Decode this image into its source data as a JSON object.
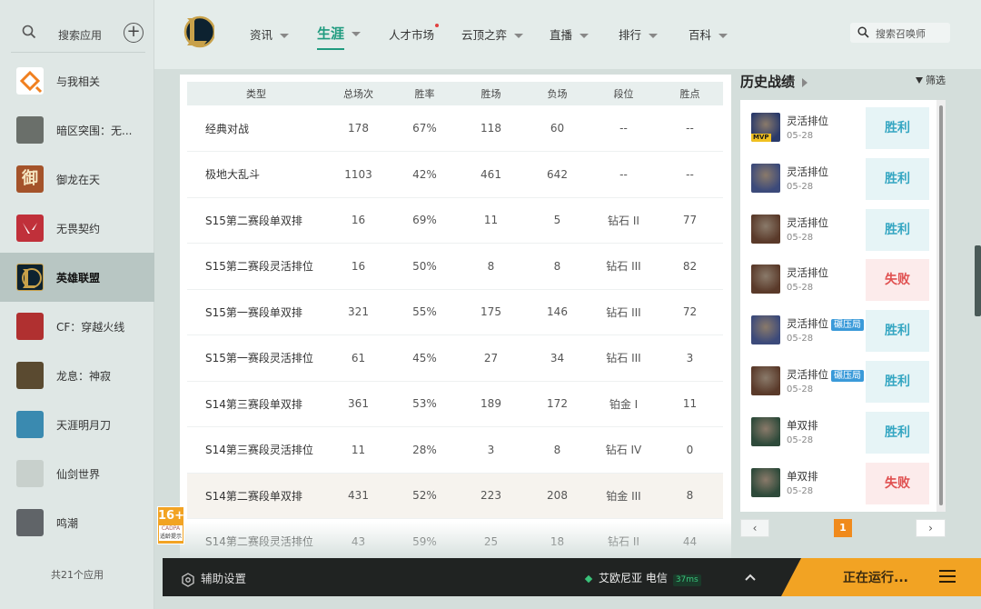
{
  "sidebar": {
    "search_label": "搜索应用",
    "items": [
      {
        "label": "与我相关",
        "icon": "related-icon"
      },
      {
        "label": "暗区突围：无...",
        "icon": "arena-breakout-game-icon"
      },
      {
        "label": "御龙在天",
        "icon": "yulong-game-icon"
      },
      {
        "label": "无畏契约",
        "icon": "valorant-game-icon"
      },
      {
        "label": "英雄联盟",
        "icon": "lol-game-icon"
      },
      {
        "label": "CF：穿越火线",
        "icon": "crossfire-game-icon"
      },
      {
        "label": "龙息：神寂",
        "icon": "longxi-game-icon"
      },
      {
        "label": "天涯明月刀",
        "icon": "tianya-game-icon"
      },
      {
        "label": "仙剑世界",
        "icon": "xianjian-game-icon"
      },
      {
        "label": "鸣潮",
        "icon": "wuthering-game-icon"
      }
    ],
    "footer": "共21个应用"
  },
  "nav": {
    "items": [
      "资讯",
      "生涯",
      "人才市场",
      "云顶之弈",
      "直播",
      "排行",
      "百科"
    ],
    "active": "生涯",
    "search_placeholder": "搜索召唤师"
  },
  "table": {
    "headers": [
      "类型",
      "总场次",
      "胜率",
      "胜场",
      "负场",
      "段位",
      "胜点"
    ],
    "rows": [
      [
        "经典对战",
        "178",
        "67%",
        "118",
        "60",
        "--",
        "--"
      ],
      [
        "极地大乱斗",
        "1103",
        "42%",
        "461",
        "642",
        "--",
        "--"
      ],
      [
        "S15第二赛段单双排",
        "16",
        "69%",
        "11",
        "5",
        "钻石 II",
        "77"
      ],
      [
        "S15第二赛段灵活排位",
        "16",
        "50%",
        "8",
        "8",
        "钻石 III",
        "82"
      ],
      [
        "S15第一赛段单双排",
        "321",
        "55%",
        "175",
        "146",
        "钻石 III",
        "72"
      ],
      [
        "S15第一赛段灵活排位",
        "61",
        "45%",
        "27",
        "34",
        "钻石 III",
        "3"
      ],
      [
        "S14第三赛段单双排",
        "361",
        "53%",
        "189",
        "172",
        "铂金 I",
        "11"
      ],
      [
        "S14第三赛段灵活排位",
        "11",
        "28%",
        "3",
        "8",
        "钻石 IV",
        "0"
      ],
      [
        "S14第二赛段单双排",
        "431",
        "52%",
        "223",
        "208",
        "铂金 III",
        "8"
      ],
      [
        "S14第二赛段灵活排位",
        "43",
        "59%",
        "25",
        "18",
        "钻石 II",
        "44"
      ]
    ]
  },
  "history": {
    "title": "历史战绩",
    "filter": "筛选",
    "matches": [
      {
        "mode": "灵活排位",
        "date": "05-28",
        "result": "胜利",
        "win": true,
        "tag": "",
        "mvp": "MVP",
        "color": "#2a3a6a"
      },
      {
        "mode": "灵活排位",
        "date": "05-28",
        "result": "胜利",
        "win": true,
        "tag": "",
        "mvp": "",
        "color": "#3c4a7a"
      },
      {
        "mode": "灵活排位",
        "date": "05-28",
        "result": "胜利",
        "win": true,
        "tag": "",
        "mvp": "",
        "color": "#5a3a2a"
      },
      {
        "mode": "灵活排位",
        "date": "05-28",
        "result": "失败",
        "win": false,
        "tag": "",
        "mvp": "",
        "color": "#5a3a2a"
      },
      {
        "mode": "灵活排位",
        "date": "05-28",
        "result": "胜利",
        "win": true,
        "tag": "碾压局",
        "mvp": "",
        "color": "#3c4a7a"
      },
      {
        "mode": "灵活排位",
        "date": "05-28",
        "result": "胜利",
        "win": true,
        "tag": "碾压局",
        "mvp": "",
        "color": "#5a3a2a"
      },
      {
        "mode": "单双排",
        "date": "05-28",
        "result": "胜利",
        "win": true,
        "tag": "",
        "mvp": "",
        "color": "#2e4a3a"
      },
      {
        "mode": "单双排",
        "date": "05-28",
        "result": "失败",
        "win": false,
        "tag": "",
        "mvp": "",
        "color": "#2e4a3a"
      }
    ],
    "page": "1",
    "prev": "‹",
    "next": "›"
  },
  "age_badge": {
    "num": "16+",
    "sub": "CADPA",
    "text": "适龄提示"
  },
  "bottom": {
    "aux_label": "辅助设置",
    "server": "艾欧尼亚 电信",
    "ping": "37ms",
    "running": "正在运行..."
  }
}
